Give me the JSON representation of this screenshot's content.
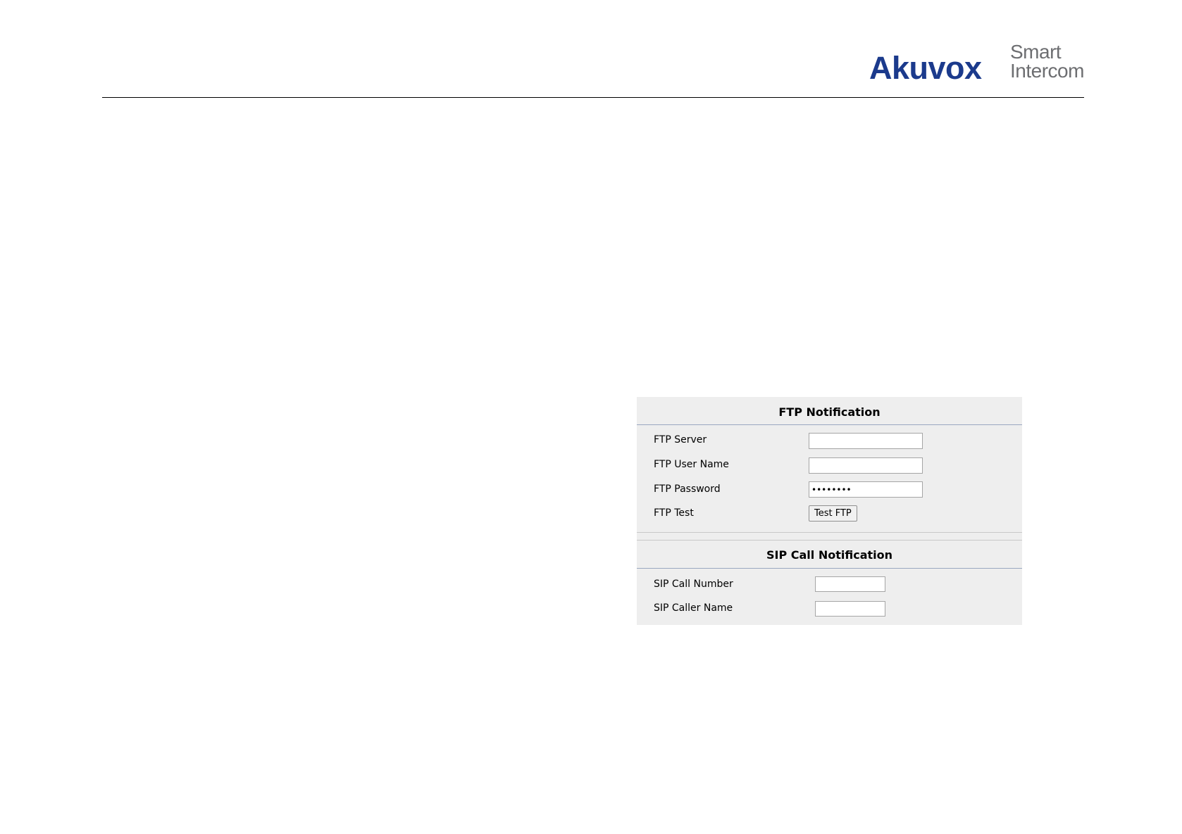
{
  "header": {
    "logo_brand": "Akuvox",
    "logo_tagline_line1": "Smart",
    "logo_tagline_line2": "Intercom"
  },
  "ftp_notification": {
    "title": "FTP Notification",
    "server_label": "FTP Server",
    "server_value": "",
    "user_name_label": "FTP User Name",
    "user_name_value": "",
    "password_label": "FTP Password",
    "password_value": "••••••••",
    "test_label": "FTP Test",
    "test_button_label": "Test FTP"
  },
  "sip_call_notification": {
    "title": "SIP Call Notification",
    "call_number_label": "SIP Call Number",
    "call_number_value": "",
    "caller_name_label": "SIP Caller Name",
    "caller_name_value": ""
  }
}
